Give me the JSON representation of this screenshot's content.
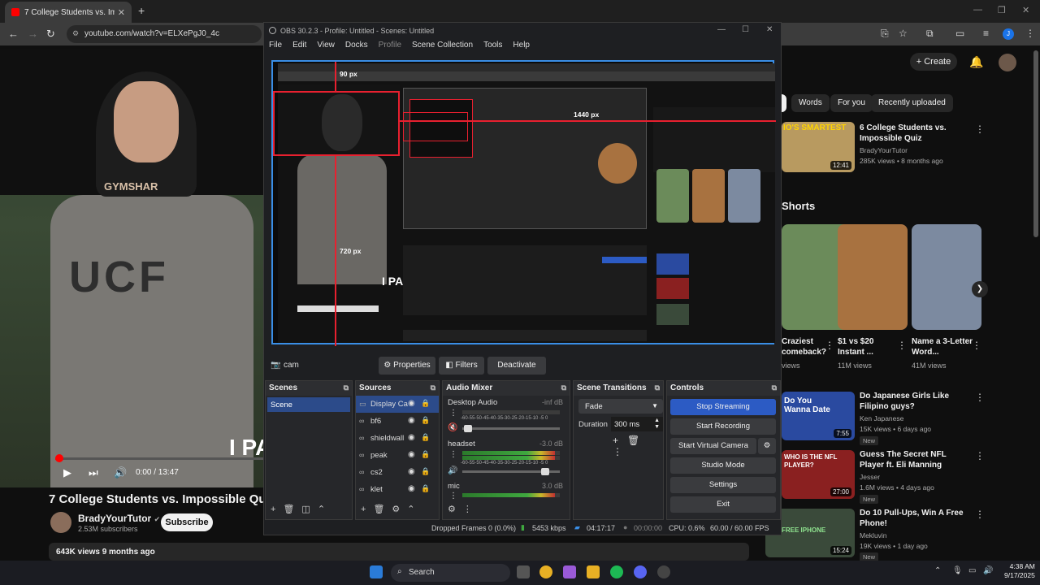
{
  "browser": {
    "tab_title": "7 College Students vs. Impossib",
    "url": "youtube.com/watch?v=ELXePgJ0_4c",
    "profile_initial": "J"
  },
  "video": {
    "title": "7 College Students vs. Impossible Quiz",
    "time": "0:00 / 13:47",
    "progress": 0.0,
    "shirt_text": "UCF",
    "hoodie_text": "GYMSHAR",
    "overlay_text": "I PA",
    "channel": "BradyYourTutor",
    "subscribers": "2.53M subscribers",
    "subscribe_label": "Subscribe",
    "views": "643K views  9 months ago"
  },
  "youtube": {
    "create_label": "Create",
    "chips": [
      "Words",
      "For you",
      "Recently uploaded"
    ],
    "rec1": {
      "title": "6 College Students vs. Impossible Quiz",
      "channel": "BradyYourTutor",
      "meta": "285K views • 8 months ago",
      "duration": "12:41",
      "thumb_text": "IO'S SMARTEST"
    },
    "shorts_heading": "Shorts",
    "shorts": [
      {
        "title": "Craziest comeback?",
        "views": "views"
      },
      {
        "title": "$1 vs $20 Instant ...",
        "views": "11M views"
      },
      {
        "title": "Name a 3-Letter Word...",
        "views": "41M views"
      }
    ],
    "recs": [
      {
        "title": "Do Japanese Girls Like Filipino guys?",
        "channel": "Ken Japanese",
        "meta": "15K views • 6 days ago",
        "duration": "7:55",
        "badge": "New",
        "thumb_text": "Do You Wanna Date"
      },
      {
        "title": "Guess The Secret NFL Player ft. Eli Manning",
        "channel": "Jesser",
        "meta": "1.6M views • 4 days ago",
        "duration": "27:00",
        "badge": "New",
        "thumb_text": "WHO IS THE NFL PLAYER?"
      },
      {
        "title": "Do 10 Pull-Ups, Win A Free Phone!",
        "channel": "Mekluvin",
        "meta": "19K views • 1 day ago",
        "duration": "15:24",
        "badge": "New",
        "thumb_text": "FREE IPHONE"
      }
    ]
  },
  "obs": {
    "title": "OBS 30.2.3 - Profile: Untitled - Scenes: Untitled",
    "menu": [
      "File",
      "Edit",
      "View",
      "Docks",
      "Profile",
      "Scene Collection",
      "Tools",
      "Help"
    ],
    "preview_labels": {
      "top": "90 px",
      "right": "1440 px",
      "bottom": "720 px"
    },
    "source_name": "cam",
    "properties_label": "Properties",
    "filters_label": "Filters",
    "deactivate_label": "Deactivate",
    "docks": {
      "scenes": "Scenes",
      "sources": "Sources",
      "audio_mixer": "Audio Mixer",
      "scene_transitions": "Scene Transitions",
      "controls": "Controls"
    },
    "scenes": [
      "Scene"
    ],
    "sources": [
      "Display Ca",
      "bf6",
      "shieldwall",
      "peak",
      "cs2",
      "klet"
    ],
    "mixer": [
      {
        "name": "Desktop Audio",
        "db": "-inf dB",
        "level": 0.0,
        "vol": 0.06
      },
      {
        "name": "headset",
        "db": "-3.0 dB",
        "level": 0.95,
        "vol": 0.85
      },
      {
        "name": "mic",
        "db": "3.0 dB",
        "level": 0.95,
        "vol": 0.85
      }
    ],
    "meter_scale": "-60-55-50-45-40-35-30-25-20-15-10 -5  0",
    "transition": "Fade",
    "duration_label": "Duration",
    "duration_value": "300 ms",
    "controls": [
      "Stop Streaming",
      "Start Recording",
      "Start Virtual Camera",
      "Studio Mode",
      "Settings",
      "Exit"
    ],
    "status": {
      "dropped": "Dropped Frames 0 (0.0%)",
      "kbps": "5453 kbps",
      "live_time": "04:17:17",
      "rec_time": "00:00:00",
      "cpu": "CPU: 0.6%",
      "fps": "60.00 / 60.00 FPS"
    }
  },
  "taskbar": {
    "search": "Search",
    "time": "4:38 AM",
    "date": "9/17/2025"
  },
  "colors": {
    "accent": "#3a8ee6",
    "youtube_red": "#ff0000",
    "obs_select": "#2c4b8a",
    "stream_btn": "#2c5bc4"
  }
}
